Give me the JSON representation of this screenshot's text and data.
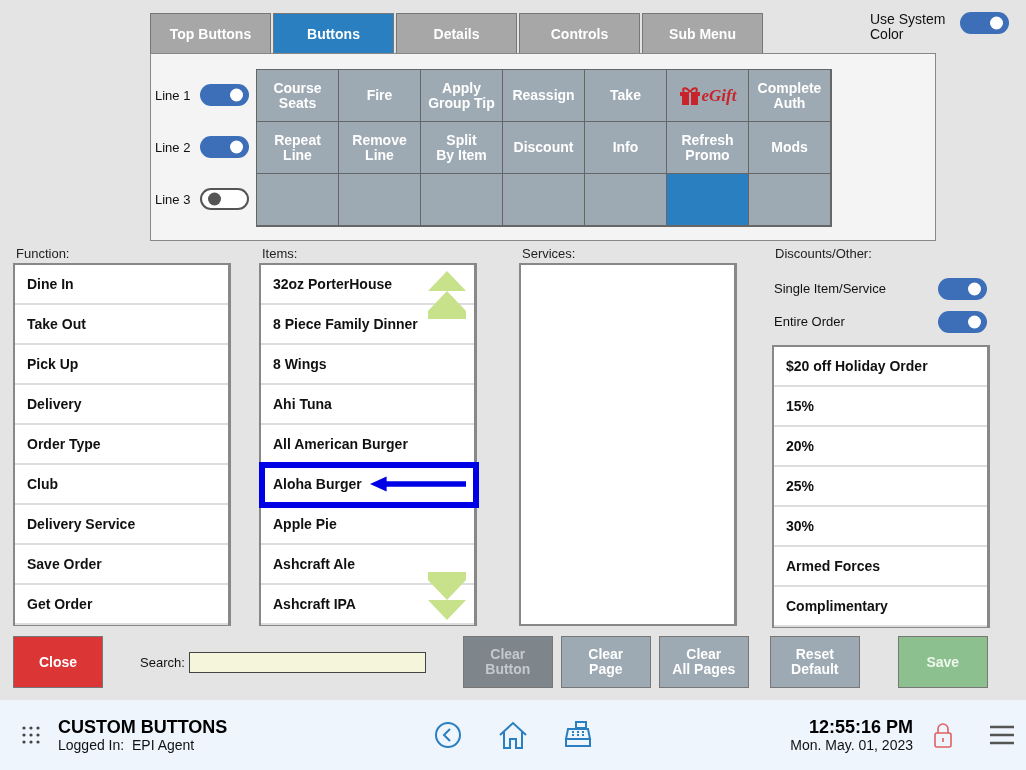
{
  "tabs": [
    {
      "label": "Top Buttons",
      "selected": false
    },
    {
      "label": "Buttons",
      "selected": true
    },
    {
      "label": "Details",
      "selected": false
    },
    {
      "label": "Controls",
      "selected": false
    },
    {
      "label": "Sub Menu",
      "selected": false
    }
  ],
  "system_color": {
    "label": "Use System Color",
    "on": true
  },
  "lines": [
    {
      "label": "Line 1",
      "on": true
    },
    {
      "label": "Line 2",
      "on": true
    },
    {
      "label": "Line 3",
      "on": false
    }
  ],
  "button_grid": [
    {
      "kind": "text",
      "label": "Course\nSeats",
      "selected": false
    },
    {
      "kind": "text",
      "label": "Fire",
      "selected": false
    },
    {
      "kind": "text",
      "label": "Apply\nGroup Tip",
      "selected": false
    },
    {
      "kind": "text",
      "label": "Reassign",
      "selected": false
    },
    {
      "kind": "text",
      "label": "Take",
      "selected": false
    },
    {
      "kind": "logo",
      "label": "eGift",
      "selected": false
    },
    {
      "kind": "text",
      "label": "Complete\nAuth",
      "selected": false
    },
    {
      "kind": "text",
      "label": "Repeat\nLine",
      "selected": false
    },
    {
      "kind": "text",
      "label": "Remove\nLine",
      "selected": false
    },
    {
      "kind": "text",
      "label": "Split\nBy Item",
      "selected": false
    },
    {
      "kind": "text",
      "label": "Discount",
      "selected": false
    },
    {
      "kind": "text",
      "label": "Info",
      "selected": false
    },
    {
      "kind": "text",
      "label": "Refresh\nPromo",
      "selected": false
    },
    {
      "kind": "text",
      "label": "Mods",
      "selected": false
    },
    {
      "kind": "empty",
      "selected": false
    },
    {
      "kind": "empty",
      "selected": false
    },
    {
      "kind": "empty",
      "selected": false
    },
    {
      "kind": "empty",
      "selected": false
    },
    {
      "kind": "empty",
      "selected": false
    },
    {
      "kind": "empty",
      "selected": true
    },
    {
      "kind": "empty",
      "selected": false
    }
  ],
  "function": {
    "label": "Function:",
    "items": [
      "Dine In",
      "Take Out",
      "Pick Up",
      "Delivery",
      "Order Type",
      "Club",
      "Delivery Service",
      "Save Order",
      "Get Order"
    ]
  },
  "items": {
    "label": "Items:",
    "items": [
      {
        "label": "32oz PorterHouse",
        "highlighted": false
      },
      {
        "label": "8 Piece Family Dinner",
        "highlighted": false
      },
      {
        "label": "8 Wings",
        "highlighted": false
      },
      {
        "label": "Ahi Tuna",
        "highlighted": false
      },
      {
        "label": "All American Burger",
        "highlighted": false
      },
      {
        "label": "Aloha Burger",
        "highlighted": true
      },
      {
        "label": "Apple Pie",
        "highlighted": false
      },
      {
        "label": "Ashcraft Ale",
        "highlighted": false
      },
      {
        "label": "Ashcraft IPA",
        "highlighted": false
      }
    ]
  },
  "services": {
    "label": "Services:"
  },
  "discounts": {
    "label": "Discounts/Other:",
    "toggles": [
      {
        "label": "Single Item/Service",
        "on": true
      },
      {
        "label": "Entire Order",
        "on": true
      }
    ],
    "items": [
      "$20 off Holiday Order",
      "15%",
      "20%",
      "25%",
      "30%",
      "Armed Forces",
      "Complimentary"
    ]
  },
  "close_button": "Close",
  "search": {
    "label": "Search:"
  },
  "actions": [
    {
      "label": "Clear\nButton",
      "disabled": true
    },
    {
      "label": "Clear\nPage",
      "disabled": false
    },
    {
      "label": "Clear\nAll Pages",
      "disabled": false
    }
  ],
  "reset_button": {
    "label": "Reset\nDefault",
    "disabled": false
  },
  "save_button": {
    "label": "Save",
    "disabled": true
  },
  "status_bar": {
    "title": "CUSTOM BUTTONS",
    "user_label": "Logged In:",
    "user": "EPI Agent",
    "time": "12:55:16 PM",
    "date": "Mon. May. 01, 2023"
  }
}
